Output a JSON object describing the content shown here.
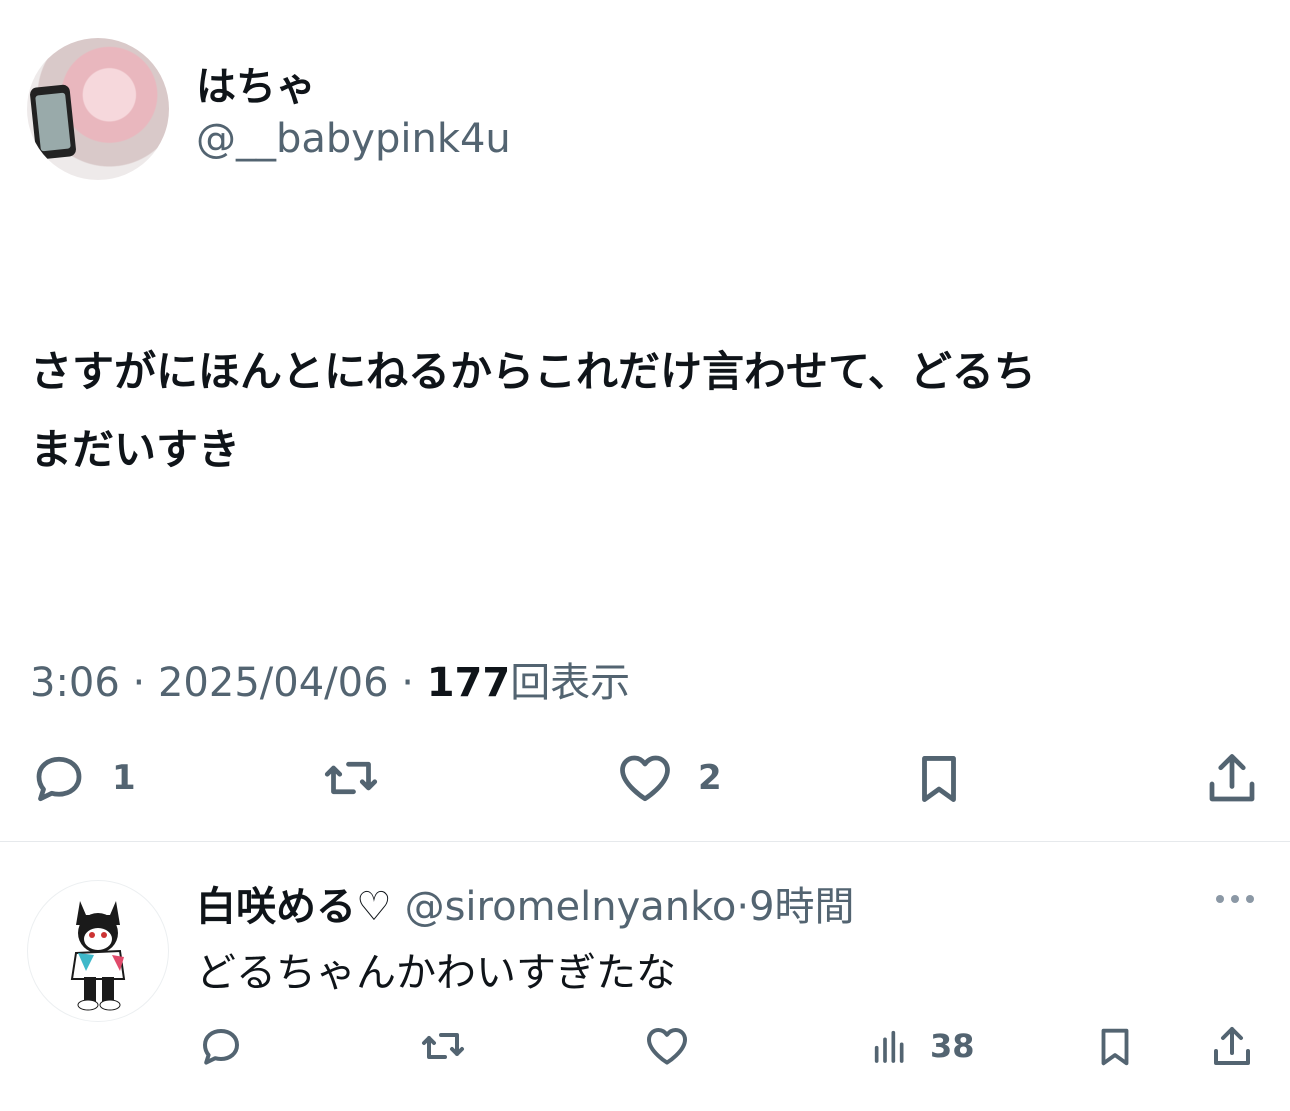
{
  "main_tweet": {
    "display_name": "はちゃ",
    "handle": "@__babypink4u",
    "text_line1": "さすがにほんとにねるからこれだけ言わせて、どるち",
    "text_line2": "まだいすき",
    "time": "3:06",
    "separator": "·",
    "date": "2025/04/06",
    "views_count": "177",
    "views_label": "回表示",
    "actions": {
      "reply_icon": "speech-bubble-icon",
      "reply_count": "1",
      "retweet_icon": "retweet-icon",
      "like_icon": "heart-icon",
      "like_count": "2",
      "bookmark_icon": "bookmark-icon",
      "share_icon": "share-icon"
    }
  },
  "reply": {
    "display_name": "白咲める♡",
    "handle": "@siromelnyanko",
    "separator": "·",
    "time_ago": "9時間",
    "text": "どるちゃんかわいすぎたな",
    "more_icon": "more-dots-icon",
    "actions": {
      "views_icon": "bar-chart-icon",
      "views_count": "38"
    }
  },
  "colors": {
    "text_primary": "#0f1419",
    "text_secondary": "#536471",
    "divider": "#e6e9ec"
  }
}
